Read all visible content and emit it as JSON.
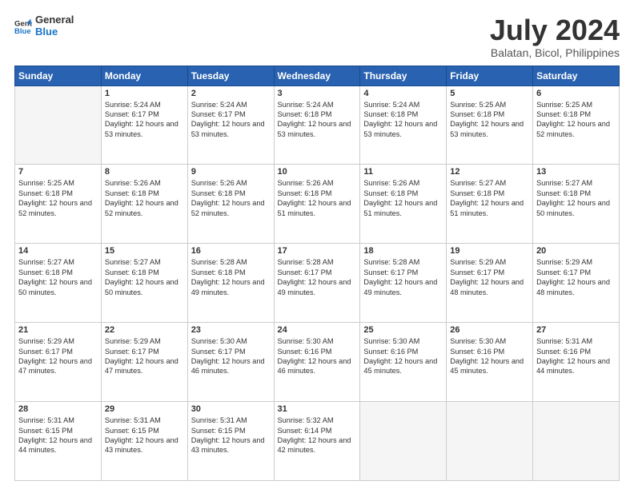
{
  "logo": {
    "line1": "General",
    "line2": "Blue"
  },
  "header": {
    "month": "July 2024",
    "location": "Balatan, Bicol, Philippines"
  },
  "weekdays": [
    "Sunday",
    "Monday",
    "Tuesday",
    "Wednesday",
    "Thursday",
    "Friday",
    "Saturday"
  ],
  "weeks": [
    [
      {
        "day": "",
        "sunrise": "",
        "sunset": "",
        "daylight": ""
      },
      {
        "day": "1",
        "sunrise": "Sunrise: 5:24 AM",
        "sunset": "Sunset: 6:17 PM",
        "daylight": "Daylight: 12 hours and 53 minutes."
      },
      {
        "day": "2",
        "sunrise": "Sunrise: 5:24 AM",
        "sunset": "Sunset: 6:17 PM",
        "daylight": "Daylight: 12 hours and 53 minutes."
      },
      {
        "day": "3",
        "sunrise": "Sunrise: 5:24 AM",
        "sunset": "Sunset: 6:18 PM",
        "daylight": "Daylight: 12 hours and 53 minutes."
      },
      {
        "day": "4",
        "sunrise": "Sunrise: 5:24 AM",
        "sunset": "Sunset: 6:18 PM",
        "daylight": "Daylight: 12 hours and 53 minutes."
      },
      {
        "day": "5",
        "sunrise": "Sunrise: 5:25 AM",
        "sunset": "Sunset: 6:18 PM",
        "daylight": "Daylight: 12 hours and 53 minutes."
      },
      {
        "day": "6",
        "sunrise": "Sunrise: 5:25 AM",
        "sunset": "Sunset: 6:18 PM",
        "daylight": "Daylight: 12 hours and 52 minutes."
      }
    ],
    [
      {
        "day": "7",
        "sunrise": "Sunrise: 5:25 AM",
        "sunset": "Sunset: 6:18 PM",
        "daylight": "Daylight: 12 hours and 52 minutes."
      },
      {
        "day": "8",
        "sunrise": "Sunrise: 5:26 AM",
        "sunset": "Sunset: 6:18 PM",
        "daylight": "Daylight: 12 hours and 52 minutes."
      },
      {
        "day": "9",
        "sunrise": "Sunrise: 5:26 AM",
        "sunset": "Sunset: 6:18 PM",
        "daylight": "Daylight: 12 hours and 52 minutes."
      },
      {
        "day": "10",
        "sunrise": "Sunrise: 5:26 AM",
        "sunset": "Sunset: 6:18 PM",
        "daylight": "Daylight: 12 hours and 51 minutes."
      },
      {
        "day": "11",
        "sunrise": "Sunrise: 5:26 AM",
        "sunset": "Sunset: 6:18 PM",
        "daylight": "Daylight: 12 hours and 51 minutes."
      },
      {
        "day": "12",
        "sunrise": "Sunrise: 5:27 AM",
        "sunset": "Sunset: 6:18 PM",
        "daylight": "Daylight: 12 hours and 51 minutes."
      },
      {
        "day": "13",
        "sunrise": "Sunrise: 5:27 AM",
        "sunset": "Sunset: 6:18 PM",
        "daylight": "Daylight: 12 hours and 50 minutes."
      }
    ],
    [
      {
        "day": "14",
        "sunrise": "Sunrise: 5:27 AM",
        "sunset": "Sunset: 6:18 PM",
        "daylight": "Daylight: 12 hours and 50 minutes."
      },
      {
        "day": "15",
        "sunrise": "Sunrise: 5:27 AM",
        "sunset": "Sunset: 6:18 PM",
        "daylight": "Daylight: 12 hours and 50 minutes."
      },
      {
        "day": "16",
        "sunrise": "Sunrise: 5:28 AM",
        "sunset": "Sunset: 6:18 PM",
        "daylight": "Daylight: 12 hours and 49 minutes."
      },
      {
        "day": "17",
        "sunrise": "Sunrise: 5:28 AM",
        "sunset": "Sunset: 6:17 PM",
        "daylight": "Daylight: 12 hours and 49 minutes."
      },
      {
        "day": "18",
        "sunrise": "Sunrise: 5:28 AM",
        "sunset": "Sunset: 6:17 PM",
        "daylight": "Daylight: 12 hours and 49 minutes."
      },
      {
        "day": "19",
        "sunrise": "Sunrise: 5:29 AM",
        "sunset": "Sunset: 6:17 PM",
        "daylight": "Daylight: 12 hours and 48 minutes."
      },
      {
        "day": "20",
        "sunrise": "Sunrise: 5:29 AM",
        "sunset": "Sunset: 6:17 PM",
        "daylight": "Daylight: 12 hours and 48 minutes."
      }
    ],
    [
      {
        "day": "21",
        "sunrise": "Sunrise: 5:29 AM",
        "sunset": "Sunset: 6:17 PM",
        "daylight": "Daylight: 12 hours and 47 minutes."
      },
      {
        "day": "22",
        "sunrise": "Sunrise: 5:29 AM",
        "sunset": "Sunset: 6:17 PM",
        "daylight": "Daylight: 12 hours and 47 minutes."
      },
      {
        "day": "23",
        "sunrise": "Sunrise: 5:30 AM",
        "sunset": "Sunset: 6:17 PM",
        "daylight": "Daylight: 12 hours and 46 minutes."
      },
      {
        "day": "24",
        "sunrise": "Sunrise: 5:30 AM",
        "sunset": "Sunset: 6:16 PM",
        "daylight": "Daylight: 12 hours and 46 minutes."
      },
      {
        "day": "25",
        "sunrise": "Sunrise: 5:30 AM",
        "sunset": "Sunset: 6:16 PM",
        "daylight": "Daylight: 12 hours and 45 minutes."
      },
      {
        "day": "26",
        "sunrise": "Sunrise: 5:30 AM",
        "sunset": "Sunset: 6:16 PM",
        "daylight": "Daylight: 12 hours and 45 minutes."
      },
      {
        "day": "27",
        "sunrise": "Sunrise: 5:31 AM",
        "sunset": "Sunset: 6:16 PM",
        "daylight": "Daylight: 12 hours and 44 minutes."
      }
    ],
    [
      {
        "day": "28",
        "sunrise": "Sunrise: 5:31 AM",
        "sunset": "Sunset: 6:15 PM",
        "daylight": "Daylight: 12 hours and 44 minutes."
      },
      {
        "day": "29",
        "sunrise": "Sunrise: 5:31 AM",
        "sunset": "Sunset: 6:15 PM",
        "daylight": "Daylight: 12 hours and 43 minutes."
      },
      {
        "day": "30",
        "sunrise": "Sunrise: 5:31 AM",
        "sunset": "Sunset: 6:15 PM",
        "daylight": "Daylight: 12 hours and 43 minutes."
      },
      {
        "day": "31",
        "sunrise": "Sunrise: 5:32 AM",
        "sunset": "Sunset: 6:14 PM",
        "daylight": "Daylight: 12 hours and 42 minutes."
      },
      {
        "day": "",
        "sunrise": "",
        "sunset": "",
        "daylight": ""
      },
      {
        "day": "",
        "sunrise": "",
        "sunset": "",
        "daylight": ""
      },
      {
        "day": "",
        "sunrise": "",
        "sunset": "",
        "daylight": ""
      }
    ]
  ]
}
